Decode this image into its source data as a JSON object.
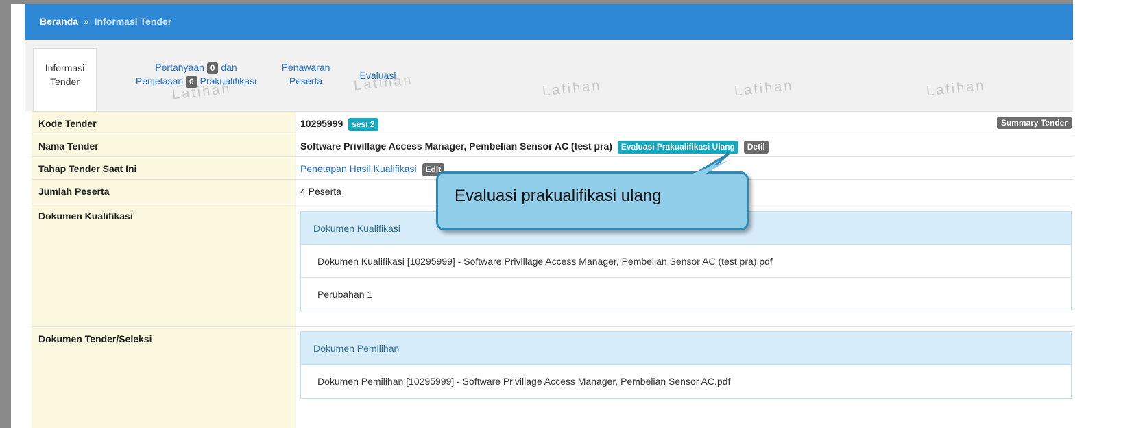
{
  "breadcrumb": {
    "home": "Beranda",
    "separator": "»",
    "current": "Informasi Tender"
  },
  "tabs": {
    "active_line1": "Informasi",
    "active_line2": "Tender",
    "pertanyaan_prefix": "Pertanyaan",
    "pertanyaan_count": "0",
    "pertanyaan_suffix": "dan",
    "penjelasan_prefix": "Penjelasan",
    "penjelasan_count": "0",
    "penjelasan_suffix": "Prakualifikasi",
    "penawaran_line1": "Penawaran",
    "penawaran_line2": "Peserta",
    "evaluasi": "Evaluasi"
  },
  "watermark": "Latihan",
  "rows": {
    "kode_label": "Kode Tender",
    "kode_value": "10295999",
    "sesi_badge": "sesi 2",
    "summary_button": "Summary Tender",
    "nama_label": "Nama Tender",
    "nama_value": "Software Privillage Access Manager, Pembelian Sensor AC (test pra)",
    "evaluasi_ulang_badge": "Evaluasi Prakualifikasi Ulang",
    "detil_badge": "Detil",
    "tahap_label": "Tahap Tender Saat Ini",
    "tahap_value": "Penetapan Hasil Kualifikasi",
    "tahap_edit_badge": "Edit",
    "jumlah_label": "Jumlah Peserta",
    "jumlah_value": "4 Peserta",
    "dok_kualifikasi_label": "Dokumen Kualifikasi",
    "dok_tender_label": "Dokumen Tender/Seleksi"
  },
  "kualifikasi_panel": {
    "heading": "Dokumen Kualifikasi",
    "file": "Dokumen Kualifikasi [10295999] - Software Privillage Access Manager, Pembelian Sensor AC (test pra).pdf",
    "perubahan": "Perubahan 1"
  },
  "pemilihan_panel": {
    "heading": "Dokumen Pemilihan",
    "file": "Dokumen Pemilihan [10295999] - Software Privillage Access Manager, Pembelian Sensor AC.pdf"
  },
  "callout": {
    "text": "Evaluasi prakualifikasi ulang"
  },
  "colors": {
    "header_blue": "#2f88d6",
    "label_bg": "#fbf8df",
    "teal_badge": "#17a8c0",
    "callout_fill": "#8fcde9",
    "callout_border": "#2d8ab8"
  }
}
